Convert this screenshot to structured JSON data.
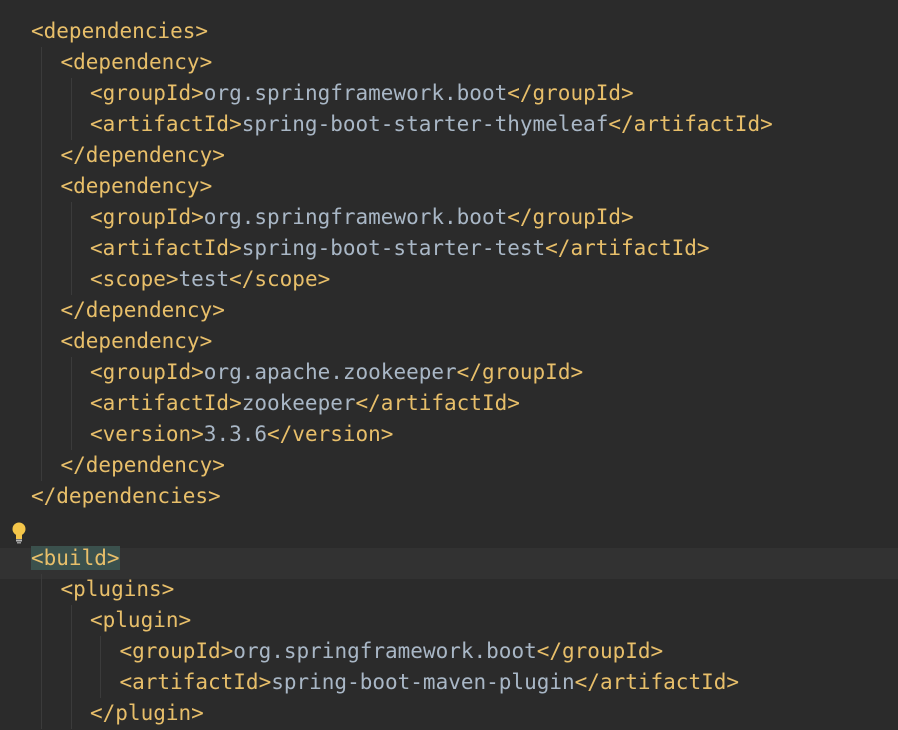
{
  "editor": {
    "language": "xml",
    "theme_colors": {
      "background": "#2b2b2b",
      "tag": "#e8bf6a",
      "text": "#a9b7c6",
      "caret_line": "#323232",
      "matched_tag": "#3b514d"
    },
    "intention_icon": "lightbulb-icon",
    "lines": [
      {
        "indent": 0,
        "open": "<dependencies>",
        "text": "",
        "close": ""
      },
      {
        "indent": 1,
        "open": "<dependency>",
        "text": "",
        "close": ""
      },
      {
        "indent": 2,
        "open": "<groupId>",
        "text": "org.springframework.boot",
        "close": "</groupId>"
      },
      {
        "indent": 2,
        "open": "<artifactId>",
        "text": "spring-boot-starter-thymeleaf",
        "close": "</artifactId>"
      },
      {
        "indent": 1,
        "open": "</dependency>",
        "text": "",
        "close": ""
      },
      {
        "indent": 1,
        "open": "<dependency>",
        "text": "",
        "close": ""
      },
      {
        "indent": 2,
        "open": "<groupId>",
        "text": "org.springframework.boot",
        "close": "</groupId>"
      },
      {
        "indent": 2,
        "open": "<artifactId>",
        "text": "spring-boot-starter-test",
        "close": "</artifactId>"
      },
      {
        "indent": 2,
        "open": "<scope>",
        "text": "test",
        "close": "</scope>"
      },
      {
        "indent": 1,
        "open": "</dependency>",
        "text": "",
        "close": ""
      },
      {
        "indent": 1,
        "open": "<dependency>",
        "text": "",
        "close": ""
      },
      {
        "indent": 2,
        "open": "<groupId>",
        "text": "org.apache.zookeeper",
        "close": "</groupId>"
      },
      {
        "indent": 2,
        "open": "<artifactId>",
        "text": "zookeeper",
        "close": "</artifactId>"
      },
      {
        "indent": 2,
        "open": "<version>",
        "text": "3.3.6",
        "close": "</version>"
      },
      {
        "indent": 1,
        "open": "</dependency>",
        "text": "",
        "close": ""
      },
      {
        "indent": 0,
        "open": "</dependencies>",
        "text": "",
        "close": ""
      },
      {
        "indent": 0,
        "open": "",
        "text": "",
        "close": ""
      },
      {
        "indent": 0,
        "open": "<build>",
        "text": "",
        "close": "",
        "highlighted": true
      },
      {
        "indent": 1,
        "open": "<plugins>",
        "text": "",
        "close": ""
      },
      {
        "indent": 2,
        "open": "<plugin>",
        "text": "",
        "close": ""
      },
      {
        "indent": 3,
        "open": "<groupId>",
        "text": "org.springframework.boot",
        "close": "</groupId>"
      },
      {
        "indent": 3,
        "open": "<artifactId>",
        "text": "spring-boot-maven-plugin",
        "close": "</artifactId>"
      },
      {
        "indent": 2,
        "open": "</plugin>",
        "text": "",
        "close": ""
      }
    ]
  }
}
